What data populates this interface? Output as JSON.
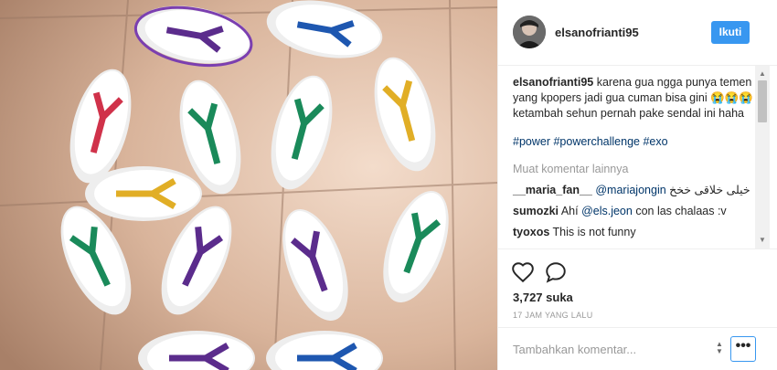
{
  "post": {
    "username": "elsanofrianti95",
    "follow_label": "Ikuti",
    "caption": "karena gua ngga punya temen yang kpopers jadi gua cuman bisa gini 😭😭😭 ketambah sehun pernah pake sendal ini haha",
    "hashtags": "#power #powerchallenge #exo",
    "load_more": "Muat komentar lainnya",
    "comments": [
      {
        "user": "__maria_fan__",
        "mention": "@mariajongin",
        "text": "خیلی خلاقی خخخ"
      },
      {
        "user": "sumozki",
        "pre": "Ahí",
        "mention": "@els.jeon",
        "text": "con las chalaas :v"
      },
      {
        "user": "tyoxos",
        "text": "This is not funny"
      }
    ],
    "likes": "3,727 suka",
    "time": "17 JAM YANG LALU",
    "comment_placeholder": "Tambahkan komentar...",
    "more_label": "•••"
  },
  "icons": {
    "like": "heart-outline-icon",
    "comment": "comment-bubble-icon",
    "more": "more-options-icon"
  },
  "colors": {
    "follow_bg": "#3897f0",
    "hashtag": "#003569",
    "muted": "#999999",
    "floor": "#cfa98f"
  }
}
